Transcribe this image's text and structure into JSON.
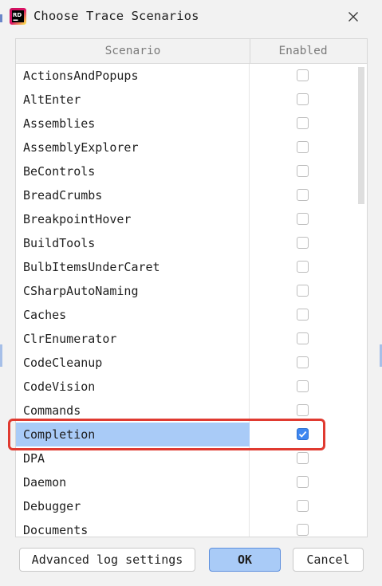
{
  "window": {
    "title": "Choose Trace Scenarios"
  },
  "table": {
    "columns": [
      "Scenario",
      "Enabled"
    ],
    "rows": [
      {
        "name": "ActionsAndPopups",
        "enabled": false
      },
      {
        "name": "AltEnter",
        "enabled": false
      },
      {
        "name": "Assemblies",
        "enabled": false
      },
      {
        "name": "AssemblyExplorer",
        "enabled": false
      },
      {
        "name": "BeControls",
        "enabled": false
      },
      {
        "name": "BreadCrumbs",
        "enabled": false
      },
      {
        "name": "BreakpointHover",
        "enabled": false
      },
      {
        "name": "BuildTools",
        "enabled": false
      },
      {
        "name": "BulbItemsUnderCaret",
        "enabled": false
      },
      {
        "name": "CSharpAutoNaming",
        "enabled": false
      },
      {
        "name": "Caches",
        "enabled": false
      },
      {
        "name": "ClrEnumerator",
        "enabled": false
      },
      {
        "name": "CodeCleanup",
        "enabled": false
      },
      {
        "name": "CodeVision",
        "enabled": false
      },
      {
        "name": "Commands",
        "enabled": false
      },
      {
        "name": "Completion",
        "enabled": true,
        "selected": true
      },
      {
        "name": "DPA",
        "enabled": false
      },
      {
        "name": "Daemon",
        "enabled": false
      },
      {
        "name": "Debugger",
        "enabled": false
      },
      {
        "name": "Documents",
        "enabled": false
      }
    ]
  },
  "footer": {
    "advanced_label": "Advanced log settings",
    "ok_label": "OK",
    "cancel_label": "Cancel"
  },
  "icons": {
    "app": "rider-app-icon",
    "close": "close-icon",
    "check": "checkmark-icon"
  },
  "colors": {
    "selection": "#a9cbf7",
    "checkbox_checked": "#3e87f0",
    "highlight": "#e03a30",
    "ok_button": "#a9cbf7"
  }
}
